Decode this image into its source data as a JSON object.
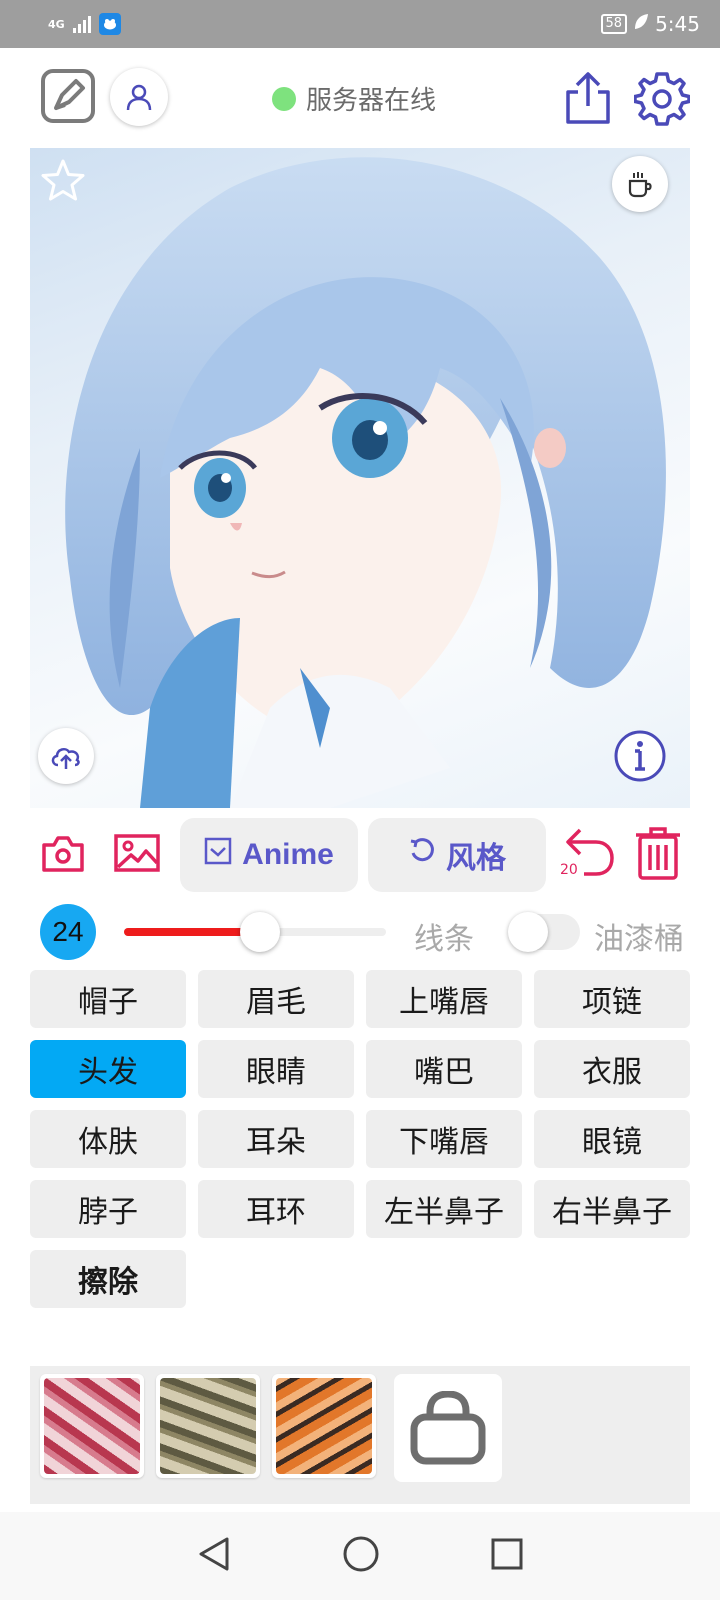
{
  "status_bar": {
    "network": "4G",
    "battery": "58",
    "time": "5:45"
  },
  "header": {
    "server_status": "服务器在线",
    "server_status_color": "#7ee27e",
    "icons": [
      "sketch-edit-icon",
      "user-icon",
      "share-icon",
      "gear-icon"
    ]
  },
  "canvas": {
    "icons": [
      "star-icon",
      "coffee-cup-icon",
      "cloud-upload-icon",
      "info-icon"
    ]
  },
  "toolbar": {
    "anime_label": "Anime",
    "style_label": "风格",
    "undo_count": "20",
    "accent_color": "#e0245e",
    "icons": [
      "camera-icon",
      "image-icon",
      "checkbox-icon",
      "refresh-icon",
      "undo-icon",
      "trash-icon"
    ]
  },
  "brush": {
    "size": "24",
    "slider_value_fraction": 0.52,
    "lines_label": "线条",
    "paint_bucket_label": "油漆桶",
    "paint_bucket_on": false
  },
  "parts": [
    {
      "label": "帽子"
    },
    {
      "label": "眉毛"
    },
    {
      "label": "上嘴唇"
    },
    {
      "label": "项链"
    },
    {
      "label": "头发",
      "selected": true
    },
    {
      "label": "眼睛"
    },
    {
      "label": "嘴巴"
    },
    {
      "label": "衣服"
    },
    {
      "label": "体肤"
    },
    {
      "label": "耳朵"
    },
    {
      "label": "下嘴唇"
    },
    {
      "label": "眼镜"
    },
    {
      "label": "脖子"
    },
    {
      "label": "耳环"
    },
    {
      "label": "左半鼻子"
    },
    {
      "label": "右半鼻子"
    },
    {
      "label": "擦除"
    }
  ],
  "styles": {
    "thumbnails": [
      "pink-pattern",
      "olive-pattern",
      "orange-pattern"
    ],
    "locked_icon": "lock-icon"
  },
  "nav": {
    "icons": [
      "back-icon",
      "home-icon",
      "recents-icon"
    ]
  }
}
